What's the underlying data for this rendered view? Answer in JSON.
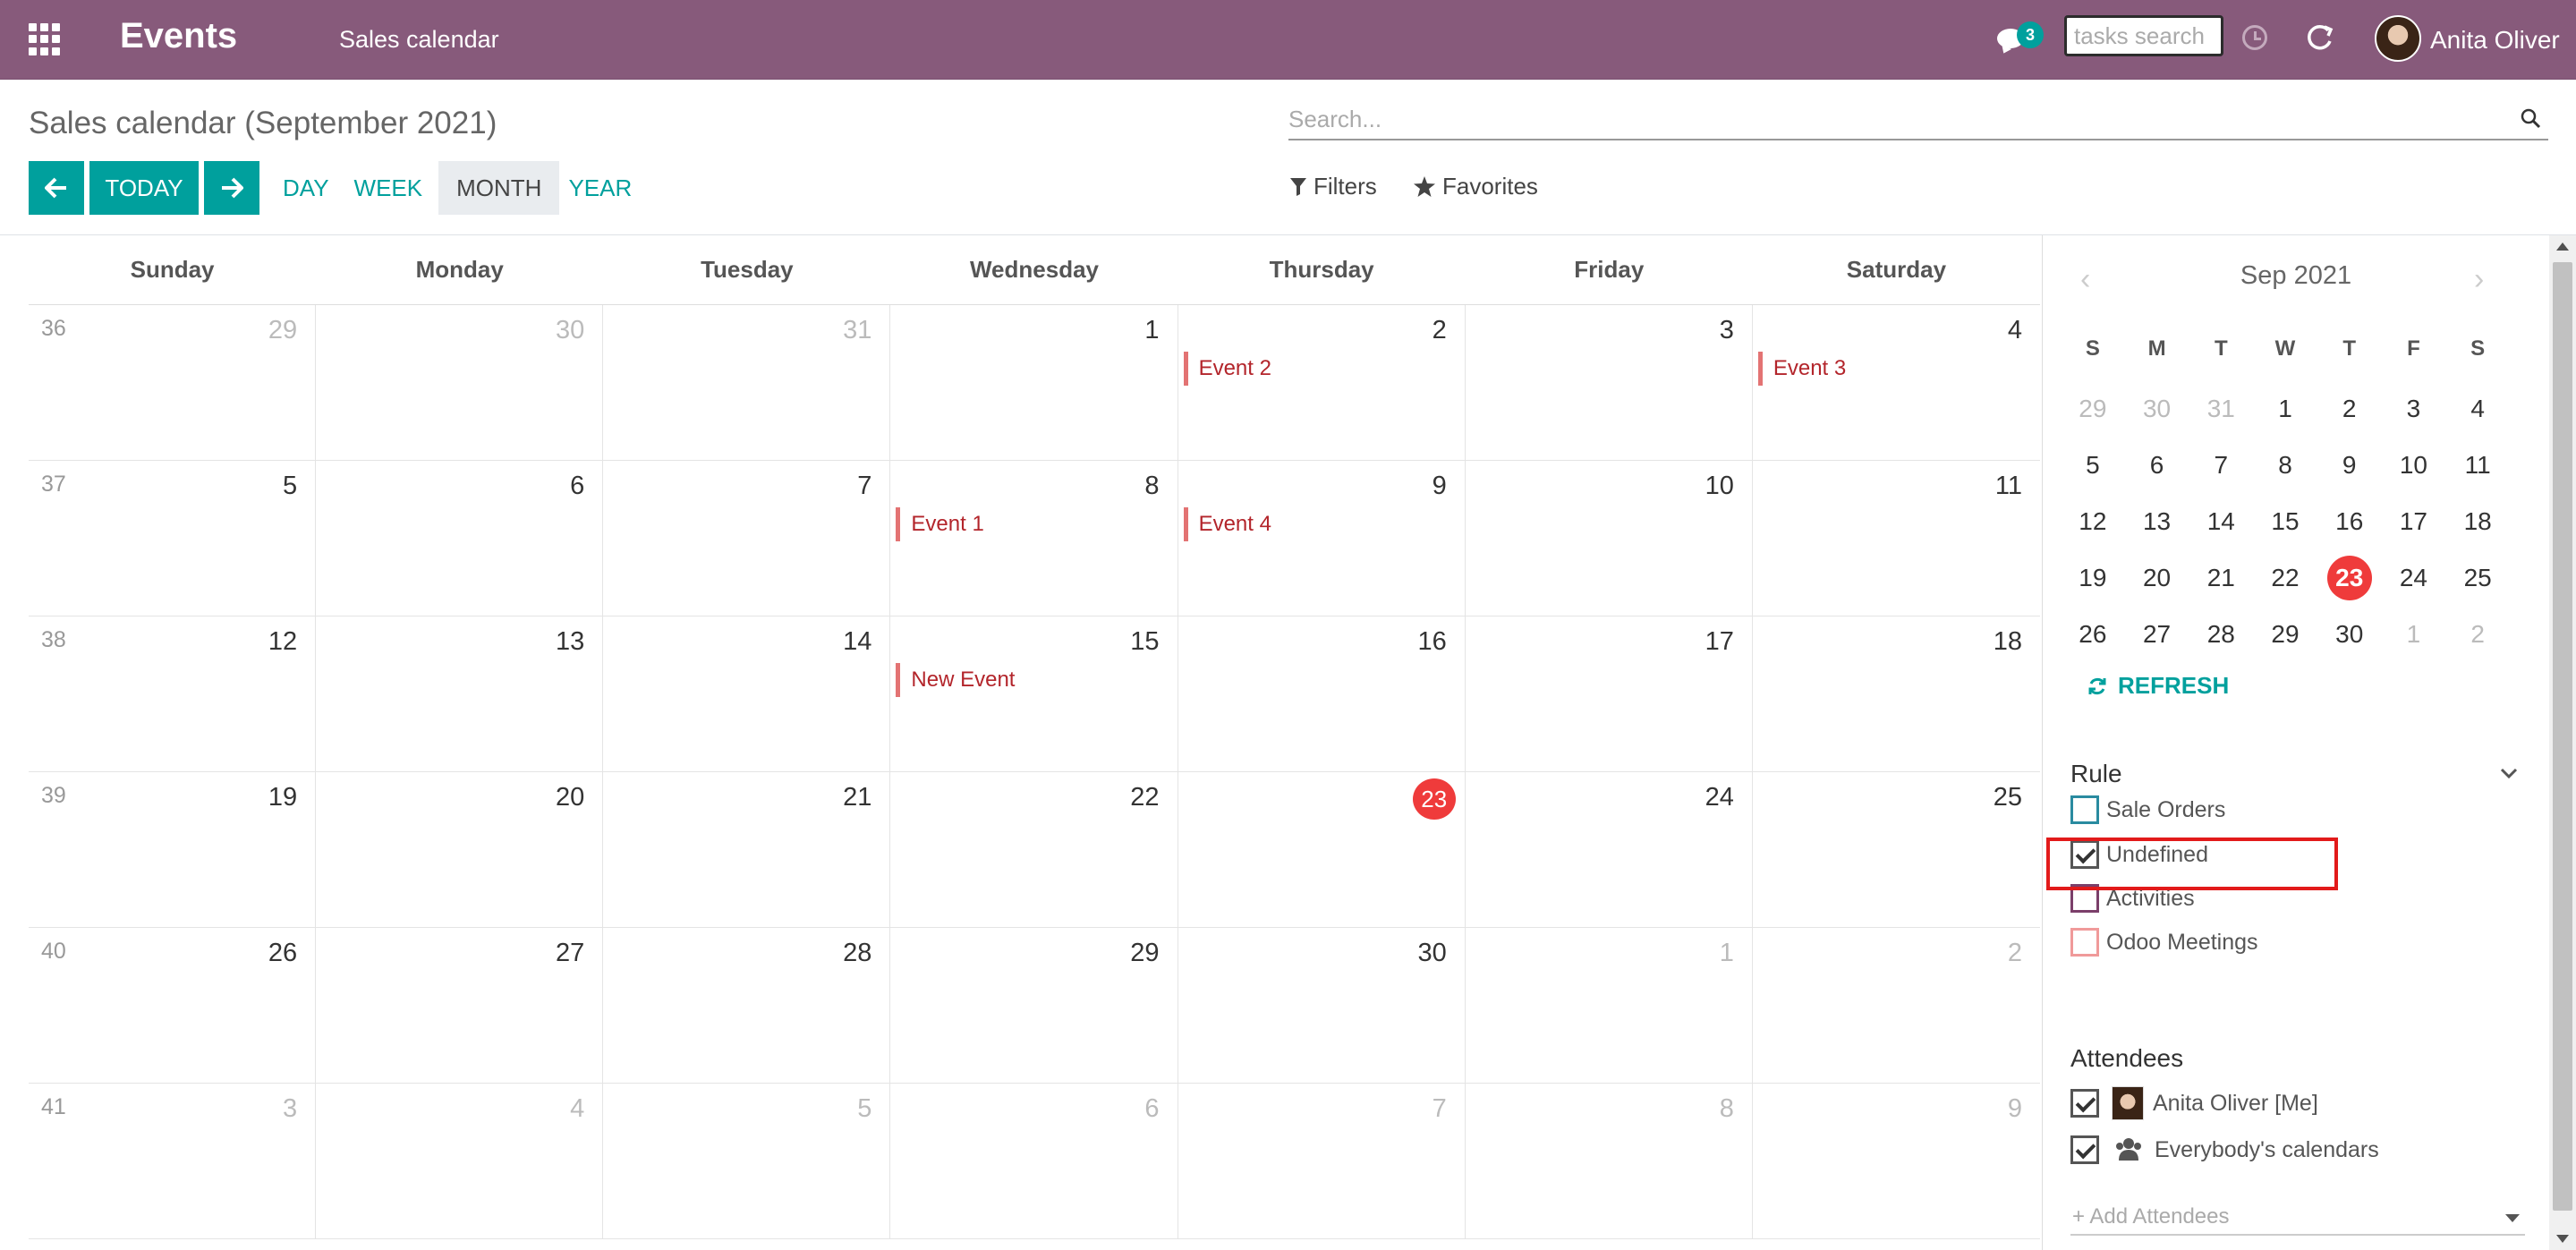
{
  "navbar": {
    "app_name": "Events",
    "menu_item": "Sales calendar",
    "chat_badge": "3",
    "tasks_search_placeholder": "tasks search",
    "user_name": "Anita Oliver",
    "color": "#875a7b"
  },
  "control_panel": {
    "breadcrumb": "Sales calendar (September 2021)",
    "search_placeholder": "Search...",
    "today_label": "TODAY",
    "ranges": [
      "DAY",
      "WEEK",
      "MONTH",
      "YEAR"
    ],
    "active_range": "MONTH",
    "filters_label": "Filters",
    "favorites_label": "Favorites",
    "accent": "#00a09d"
  },
  "calendar": {
    "day_headers": [
      "Sunday",
      "Monday",
      "Tuesday",
      "Wednesday",
      "Thursday",
      "Friday",
      "Saturday"
    ],
    "weeks": [
      {
        "num": "36",
        "days": [
          {
            "d": "29",
            "muted": true
          },
          {
            "d": "30",
            "muted": true
          },
          {
            "d": "31",
            "muted": true
          },
          {
            "d": "1"
          },
          {
            "d": "2",
            "event": "Event 2"
          },
          {
            "d": "3"
          },
          {
            "d": "4",
            "event": "Event 3"
          }
        ]
      },
      {
        "num": "37",
        "days": [
          {
            "d": "5"
          },
          {
            "d": "6"
          },
          {
            "d": "7"
          },
          {
            "d": "8",
            "event": "Event 1"
          },
          {
            "d": "9",
            "event": "Event 4"
          },
          {
            "d": "10"
          },
          {
            "d": "11"
          }
        ]
      },
      {
        "num": "38",
        "days": [
          {
            "d": "12"
          },
          {
            "d": "13"
          },
          {
            "d": "14"
          },
          {
            "d": "15",
            "event": "New Event"
          },
          {
            "d": "16"
          },
          {
            "d": "17"
          },
          {
            "d": "18"
          }
        ]
      },
      {
        "num": "39",
        "days": [
          {
            "d": "19"
          },
          {
            "d": "20"
          },
          {
            "d": "21"
          },
          {
            "d": "22"
          },
          {
            "d": "23",
            "today": true
          },
          {
            "d": "24"
          },
          {
            "d": "25"
          }
        ]
      },
      {
        "num": "40",
        "days": [
          {
            "d": "26"
          },
          {
            "d": "27"
          },
          {
            "d": "28"
          },
          {
            "d": "29"
          },
          {
            "d": "30"
          },
          {
            "d": "1",
            "muted": true
          },
          {
            "d": "2",
            "muted": true
          }
        ]
      },
      {
        "num": "41",
        "days": [
          {
            "d": "3",
            "muted": true
          },
          {
            "d": "4",
            "muted": true
          },
          {
            "d": "5",
            "muted": true
          },
          {
            "d": "6",
            "muted": true
          },
          {
            "d": "7",
            "muted": true
          },
          {
            "d": "8",
            "muted": true
          },
          {
            "d": "9",
            "muted": true
          }
        ]
      }
    ],
    "event_color": "#e37373",
    "today_color": "#ef3b3b"
  },
  "sidebar": {
    "mini_title": "Sep 2021",
    "prev_glyph": "‹",
    "next_glyph": "›",
    "dow": [
      "S",
      "M",
      "T",
      "W",
      "T",
      "F",
      "S"
    ],
    "mini_weeks": [
      [
        {
          "d": "29",
          "muted": true
        },
        {
          "d": "30",
          "muted": true
        },
        {
          "d": "31",
          "muted": true
        },
        {
          "d": "1"
        },
        {
          "d": "2"
        },
        {
          "d": "3"
        },
        {
          "d": "4"
        }
      ],
      [
        {
          "d": "5"
        },
        {
          "d": "6"
        },
        {
          "d": "7"
        },
        {
          "d": "8"
        },
        {
          "d": "9"
        },
        {
          "d": "10"
        },
        {
          "d": "11"
        }
      ],
      [
        {
          "d": "12"
        },
        {
          "d": "13"
        },
        {
          "d": "14"
        },
        {
          "d": "15"
        },
        {
          "d": "16"
        },
        {
          "d": "17"
        },
        {
          "d": "18"
        }
      ],
      [
        {
          "d": "19"
        },
        {
          "d": "20"
        },
        {
          "d": "21"
        },
        {
          "d": "22"
        },
        {
          "d": "23",
          "today": true
        },
        {
          "d": "24"
        },
        {
          "d": "25"
        }
      ],
      [
        {
          "d": "26"
        },
        {
          "d": "27"
        },
        {
          "d": "28"
        },
        {
          "d": "29"
        },
        {
          "d": "30"
        },
        {
          "d": "1",
          "muted": true
        },
        {
          "d": "2",
          "muted": true
        }
      ]
    ],
    "refresh_label": "REFRESH",
    "rule_title": "Rule",
    "rule_items": [
      {
        "label": "Sale Orders",
        "checked": false,
        "color": "#2a8ba0"
      },
      {
        "label": "Undefined",
        "checked": true,
        "color": "#555555"
      },
      {
        "label": "Activities",
        "checked": false,
        "color": "#7b3f6a"
      },
      {
        "label": "Odoo Meetings",
        "checked": false,
        "color": "#f09a9a"
      }
    ],
    "attendees_title": "Attendees",
    "attendees": [
      {
        "label": "Anita Oliver [Me]",
        "checked": true
      },
      {
        "label": "Everybody's calendars",
        "checked": true
      }
    ],
    "add_attendees_placeholder": "+ Add Attendees"
  }
}
